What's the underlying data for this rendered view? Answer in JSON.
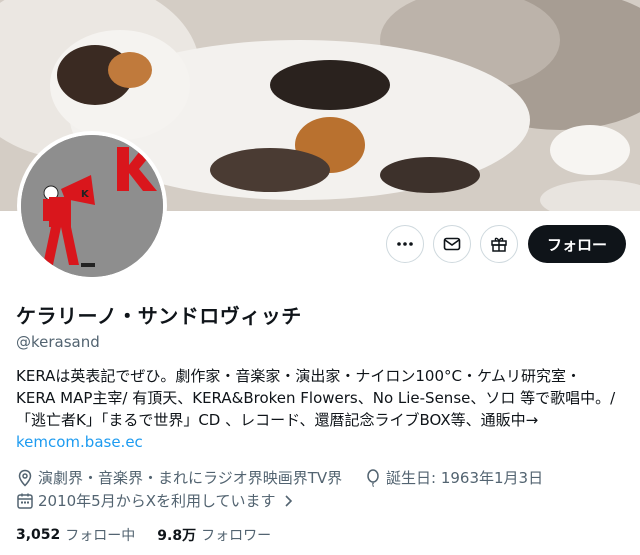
{
  "profile": {
    "display_name": "ケラリーノ・サンドロヴィッチ",
    "handle": "@kerasand",
    "bio_lines": [
      "KERAは英表記でぜひ。劇作家・音楽家・演出家・ナイロン100°C・ケムリ研究室・",
      "KERA MAP主宰/ 有頂天、KERA&Broken Flowers、No Lie-Sense、ソロ 等で歌唱中。/",
      "「逃亡者K」「まるで世界」CD 、レコード、還暦記念ライブBOX等、通販中→"
    ],
    "link": "kemcom.base.ec",
    "location": "演劇界・音楽界・まれにラジオ界映画界TV界",
    "birthday": "誕生日: 1963年1月3日",
    "joined": "2010年5月からXを利用しています",
    "following_count": "3,052",
    "following_label": "フォロー中",
    "followers_count": "9.8万",
    "followers_label": "フォロワー"
  },
  "actions": {
    "more_icon": "more-icon",
    "message_icon": "mail-icon",
    "gift_icon": "gift-icon",
    "follow_label": "フォロー"
  },
  "colors": {
    "link": "#1d9bf0",
    "secondary_text": "#536471",
    "follow_bg": "#0f1419",
    "avatar_red": "#d9161c"
  }
}
